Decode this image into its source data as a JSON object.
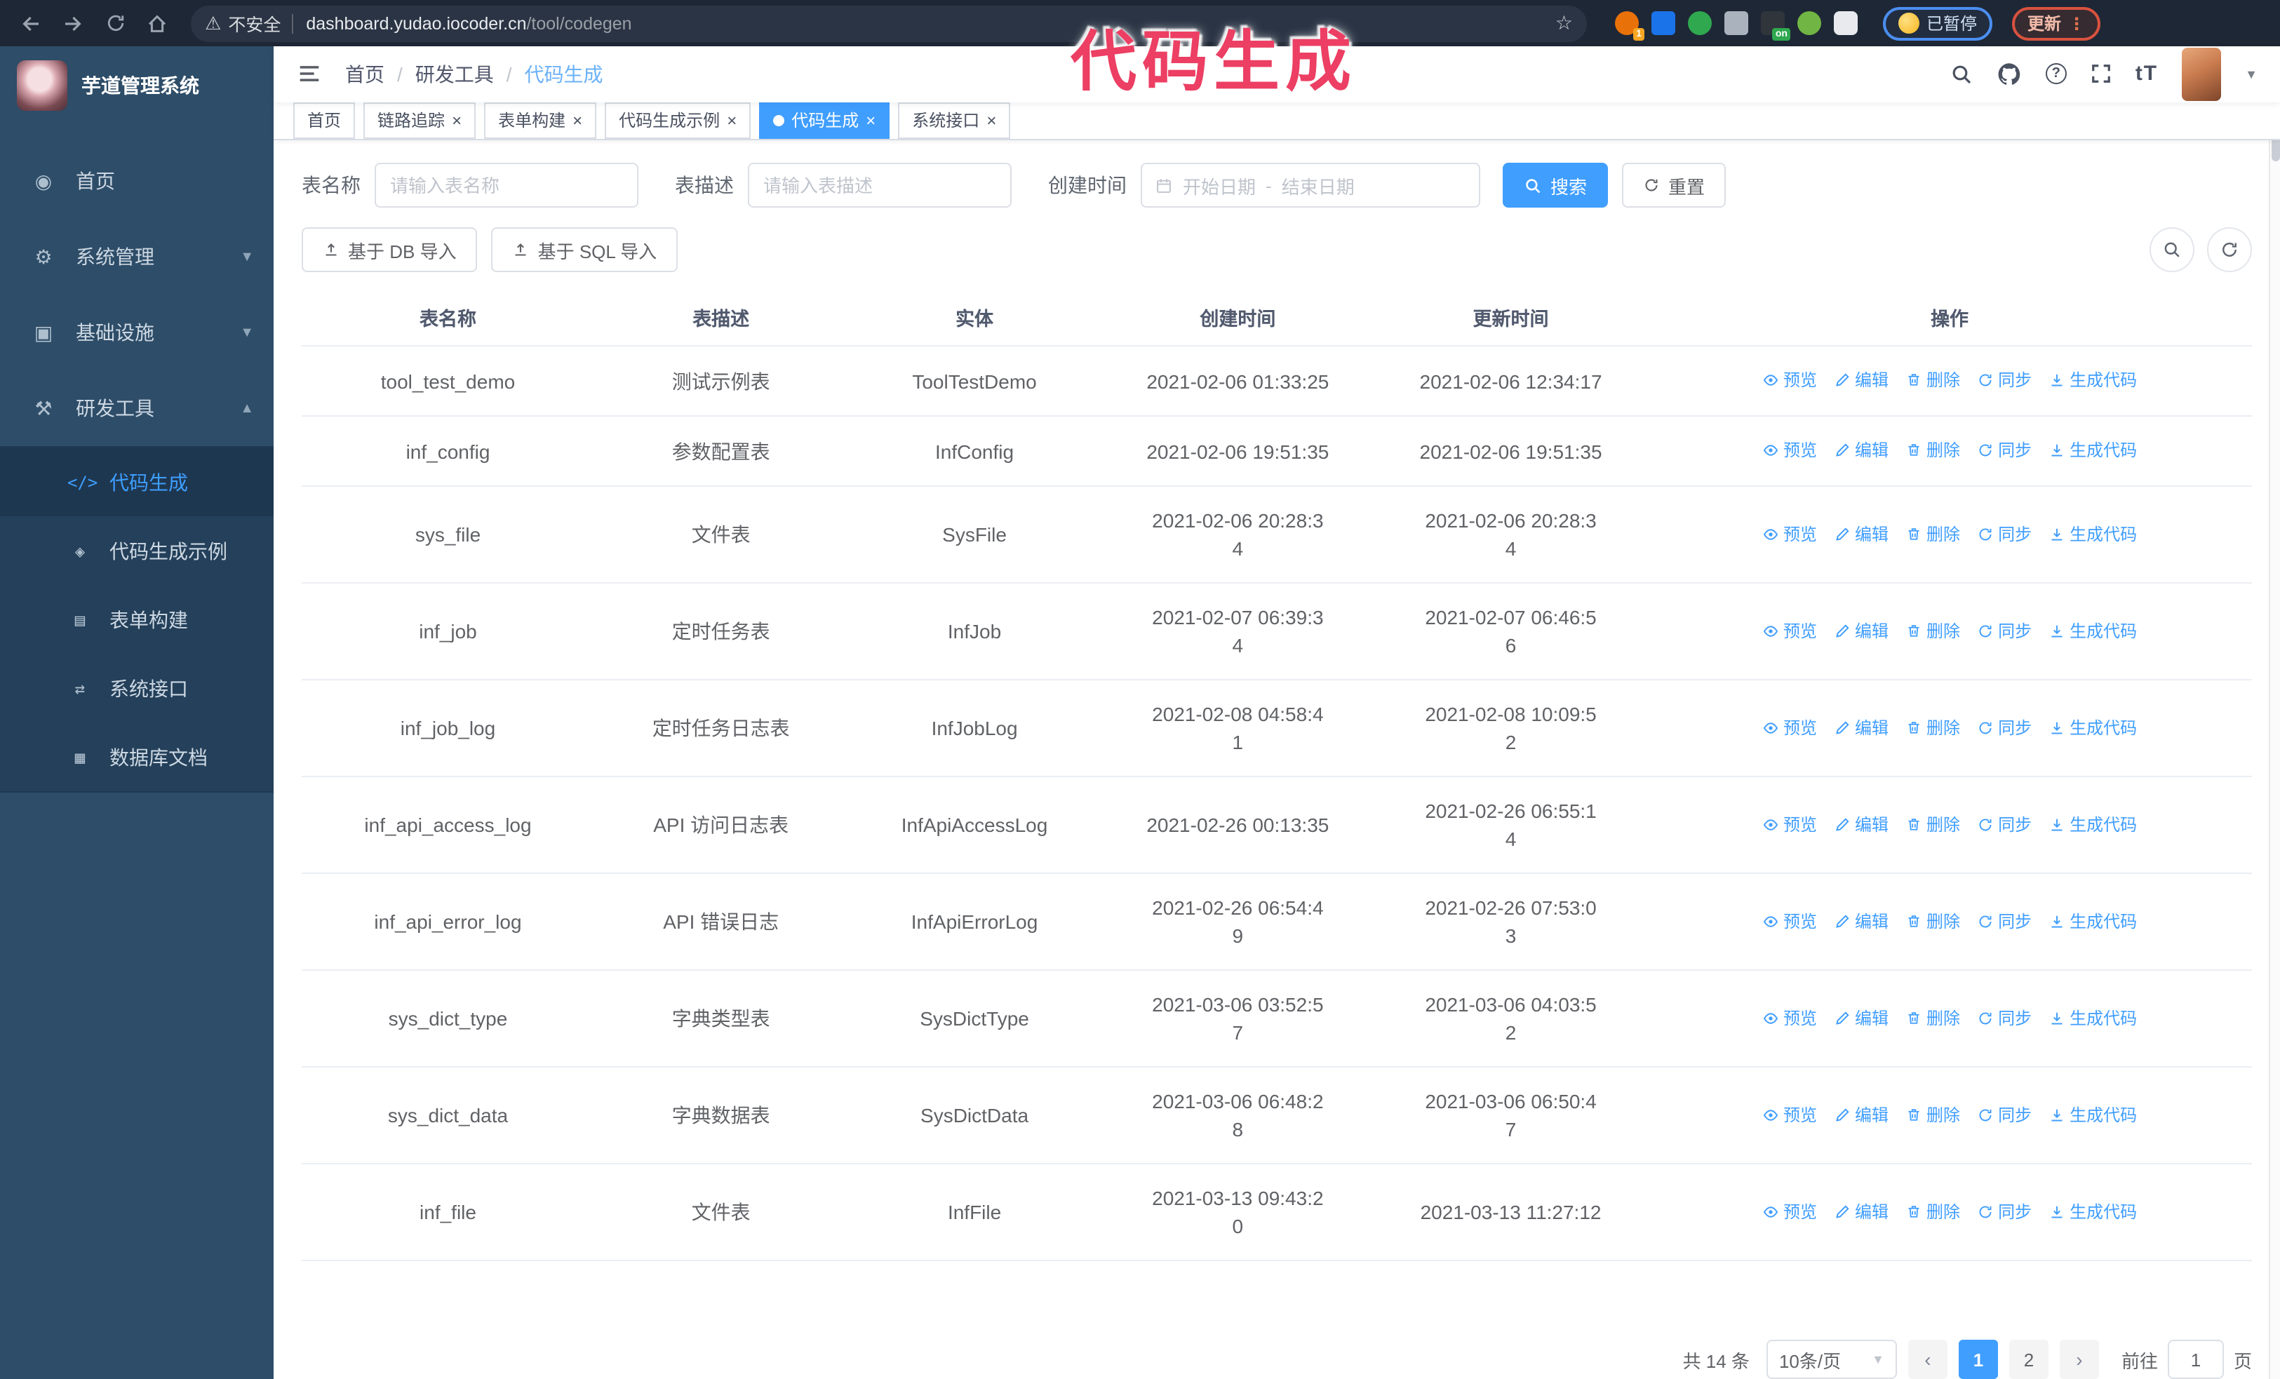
{
  "browser": {
    "security_warning": "不安全",
    "url_domain": "dashboard.yudao.iocoder.cn",
    "url_path": "/tool/codegen",
    "paused_badge": "已暂停",
    "update_button": "更新",
    "extensions": [
      {
        "name": "ext-orange-circle",
        "color": "#e8710a",
        "radius": "50%",
        "badge": "1",
        "badge_color": "#f5a623"
      },
      {
        "name": "ext-blue-gem",
        "color": "#1a73e8",
        "radius": "3px"
      },
      {
        "name": "ext-green-check",
        "color": "#2fa84f",
        "radius": "50%"
      },
      {
        "name": "ext-gray-grid",
        "color": "#aab2bd",
        "radius": "3px"
      },
      {
        "name": "ext-dark-on",
        "color": "#30353c",
        "radius": "3px",
        "badge": "on",
        "badge_color": "#2fa84f"
      },
      {
        "name": "ext-green-bot",
        "color": "#71b544",
        "radius": "50%"
      },
      {
        "name": "ext-white-puzzle",
        "color": "#e8eaed",
        "radius": "4px"
      }
    ]
  },
  "annotation": {
    "text": "代码生成",
    "color": "#ec3f63"
  },
  "sidebar": {
    "logo_title": "芋道管理系统",
    "items": [
      {
        "label": "首页",
        "icon": "dashboard-icon",
        "glyph": "◉",
        "chevron": ""
      },
      {
        "label": "系统管理",
        "icon": "gear-icon",
        "glyph": "⚙",
        "chevron": "▼"
      },
      {
        "label": "基础设施",
        "icon": "monitor-icon",
        "glyph": "▣",
        "chevron": "▼"
      },
      {
        "label": "研发工具",
        "icon": "briefcase-icon",
        "glyph": "⚒",
        "chevron": "▲"
      }
    ],
    "subitems": [
      {
        "label": "代码生成",
        "icon": "code-icon",
        "glyph": "</>",
        "active": true
      },
      {
        "label": "代码生成示例",
        "icon": "badge-check-icon",
        "glyph": "◈",
        "active": false
      },
      {
        "label": "表单构建",
        "icon": "form-icon",
        "glyph": "▤",
        "active": false
      },
      {
        "label": "系统接口",
        "icon": "sliders-icon",
        "glyph": "⇄",
        "active": false
      },
      {
        "label": "数据库文档",
        "icon": "db-doc-icon",
        "glyph": "▦",
        "active": false
      }
    ]
  },
  "navbar": {
    "breadcrumb": [
      "首页",
      "研发工具",
      "代码生成"
    ]
  },
  "tabs": [
    {
      "label": "首页",
      "closable": false,
      "active": false
    },
    {
      "label": "链路追踪",
      "closable": true,
      "active": false
    },
    {
      "label": "表单构建",
      "closable": true,
      "active": false
    },
    {
      "label": "代码生成示例",
      "closable": true,
      "active": false
    },
    {
      "label": "代码生成",
      "closable": true,
      "active": true
    },
    {
      "label": "系统接口",
      "closable": true,
      "active": false
    }
  ],
  "filters": {
    "name_label": "表名称",
    "name_placeholder": "请输入表名称",
    "desc_label": "表描述",
    "desc_placeholder": "请输入表描述",
    "date_label": "创建时间",
    "date_start": "开始日期",
    "date_sep": "-",
    "date_end": "结束日期",
    "search_label": "搜索",
    "reset_label": "重置"
  },
  "toolbar": {
    "db_import": "基于 DB 导入",
    "sql_import": "基于 SQL 导入"
  },
  "table": {
    "columns": [
      "表名称",
      "表描述",
      "实体",
      "创建时间",
      "更新时间",
      "操作"
    ],
    "actions": [
      {
        "name": "preview",
        "label": "预览",
        "icon": "eye"
      },
      {
        "name": "edit",
        "label": "编辑",
        "icon": "edit"
      },
      {
        "name": "delete",
        "label": "删除",
        "icon": "trash"
      },
      {
        "name": "sync",
        "label": "同步",
        "icon": "sync"
      },
      {
        "name": "generate-code",
        "label": "生成代码",
        "icon": "download"
      }
    ],
    "rows": [
      {
        "name": "tool_test_demo",
        "desc": "测试示例表",
        "entity": "ToolTestDemo",
        "created": "2021-02-06 01:33:25",
        "updated": "2021-02-06 12:34:17"
      },
      {
        "name": "inf_config",
        "desc": "参数配置表",
        "entity": "InfConfig",
        "created": "2021-02-06 19:51:35",
        "updated": "2021-02-06 19:51:35"
      },
      {
        "name": "sys_file",
        "desc": "文件表",
        "entity": "SysFile",
        "created": "2021-02-06 20:28:3\n4",
        "updated": "2021-02-06 20:28:3\n4"
      },
      {
        "name": "inf_job",
        "desc": "定时任务表",
        "entity": "InfJob",
        "created": "2021-02-07 06:39:3\n4",
        "updated": "2021-02-07 06:46:5\n6"
      },
      {
        "name": "inf_job_log",
        "desc": "定时任务日志表",
        "entity": "InfJobLog",
        "created": "2021-02-08 04:58:4\n1",
        "updated": "2021-02-08 10:09:5\n2"
      },
      {
        "name": "inf_api_access_log",
        "desc": "API 访问日志表",
        "entity": "InfApiAccessLog",
        "created": "2021-02-26 00:13:35",
        "updated": "2021-02-26 06:55:1\n4"
      },
      {
        "name": "inf_api_error_log",
        "desc": "API 错误日志",
        "entity": "InfApiErrorLog",
        "created": "2021-02-26 06:54:4\n9",
        "updated": "2021-02-26 07:53:0\n3"
      },
      {
        "name": "sys_dict_type",
        "desc": "字典类型表",
        "entity": "SysDictType",
        "created": "2021-03-06 03:52:5\n7",
        "updated": "2021-03-06 04:03:5\n2"
      },
      {
        "name": "sys_dict_data",
        "desc": "字典数据表",
        "entity": "SysDictData",
        "created": "2021-03-06 06:48:2\n8",
        "updated": "2021-03-06 06:50:4\n7"
      },
      {
        "name": "inf_file",
        "desc": "文件表",
        "entity": "InfFile",
        "created": "2021-03-13 09:43:2\n0",
        "updated": "2021-03-13 11:27:12"
      }
    ]
  },
  "pagination": {
    "total": "共 14 条",
    "page_size": "10条/页",
    "pages": [
      "1",
      "2"
    ],
    "active_page": "1",
    "goto_label": "前往",
    "goto_value": "1",
    "goto_suffix": "页"
  }
}
